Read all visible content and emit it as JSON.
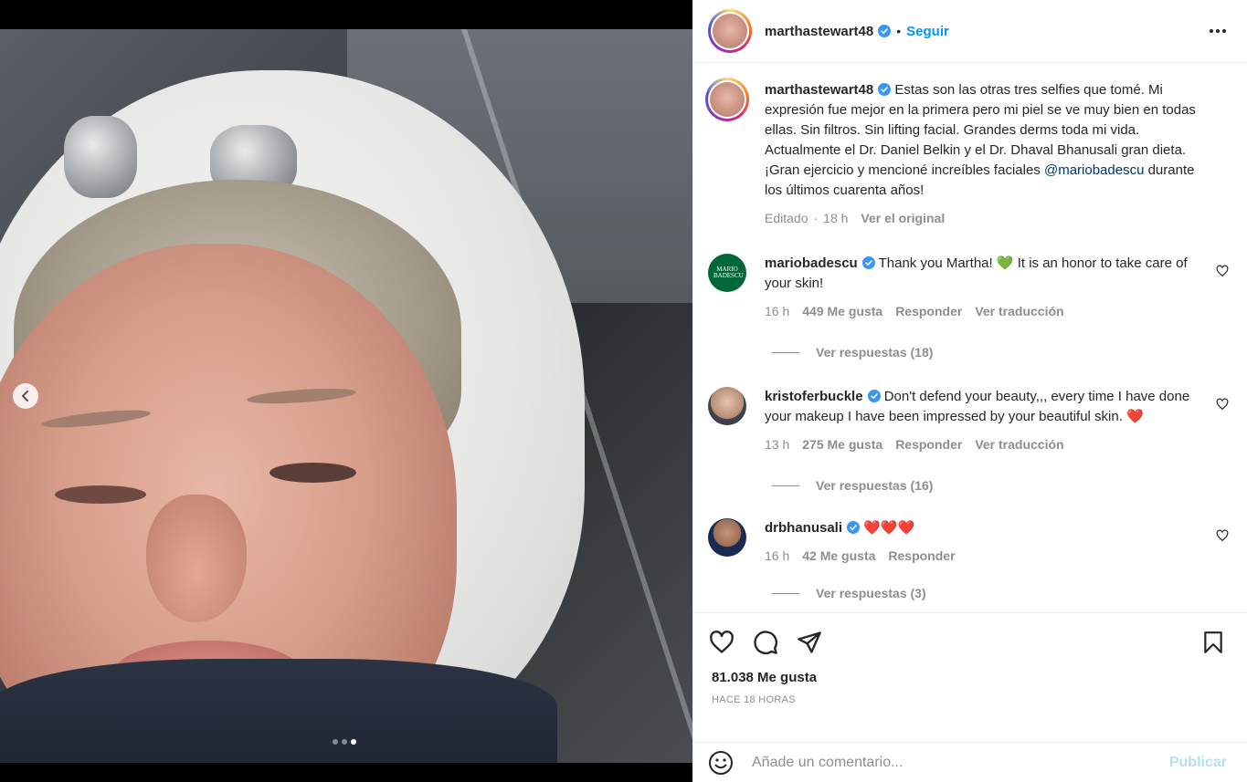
{
  "post": {
    "username": "marthastewart48",
    "follow_label": "Seguir",
    "separator": "•",
    "caption": {
      "username": "marthastewart48",
      "text_before": " Estas son las otras tres selfies que tomé. Mi expresión fue mejor en la primera pero mi piel se ve muy bien en todas ellas. Sin filtros. Sin lifting facial. Grandes derms toda mi vida. Actualmente el Dr. Daniel Belkin y el Dr. Dhaval Bhanusali gran dieta. ¡Gran ejercicio y mencioné increíbles faciales ",
      "mention": "@mariobadescu",
      "text_after": " durante los últimos cuarenta años!",
      "edited": "Editado",
      "time": "18 h",
      "original_link": "Ver el original"
    },
    "carousel": {
      "current": 3,
      "total": 3
    }
  },
  "comments": [
    {
      "username": "mariobadescu",
      "avatar_text": "MARIO BADESCU",
      "text_before": " Thank you Martha! ",
      "emoji": "💚",
      "text_after": " It is an honor to take care of your skin!",
      "time": "16 h",
      "likes": "449 Me gusta",
      "reply": "Responder",
      "translate": "Ver traducción",
      "replies": "Ver respuestas (18)"
    },
    {
      "username": "kristoferbuckle",
      "text_before": " Don't defend your beauty,,, every time I have done your makeup I have been impressed by your beautiful skin. ",
      "emoji": "❤️",
      "time": "13 h",
      "likes": "275 Me gusta",
      "reply": "Responder",
      "translate": "Ver traducción",
      "replies": "Ver respuestas (16)"
    },
    {
      "username": "drbhanusali",
      "text_before": " ",
      "emoji": "❤️❤️❤️",
      "time": "16 h",
      "likes": "42 Me gusta",
      "reply": "Responder",
      "replies": "Ver respuestas (3)"
    }
  ],
  "actions": {
    "likes": "81.038 Me gusta",
    "time": "HACE 18 HORAS"
  },
  "add_comment": {
    "placeholder": "Añade un comentario...",
    "publish": "Publicar"
  },
  "colors": {
    "link_blue": "#0095f6",
    "publish_disabled": "#b2dffc",
    "mention": "#00376b",
    "muted": "#8e8e8e",
    "verified": "#3897f0"
  }
}
